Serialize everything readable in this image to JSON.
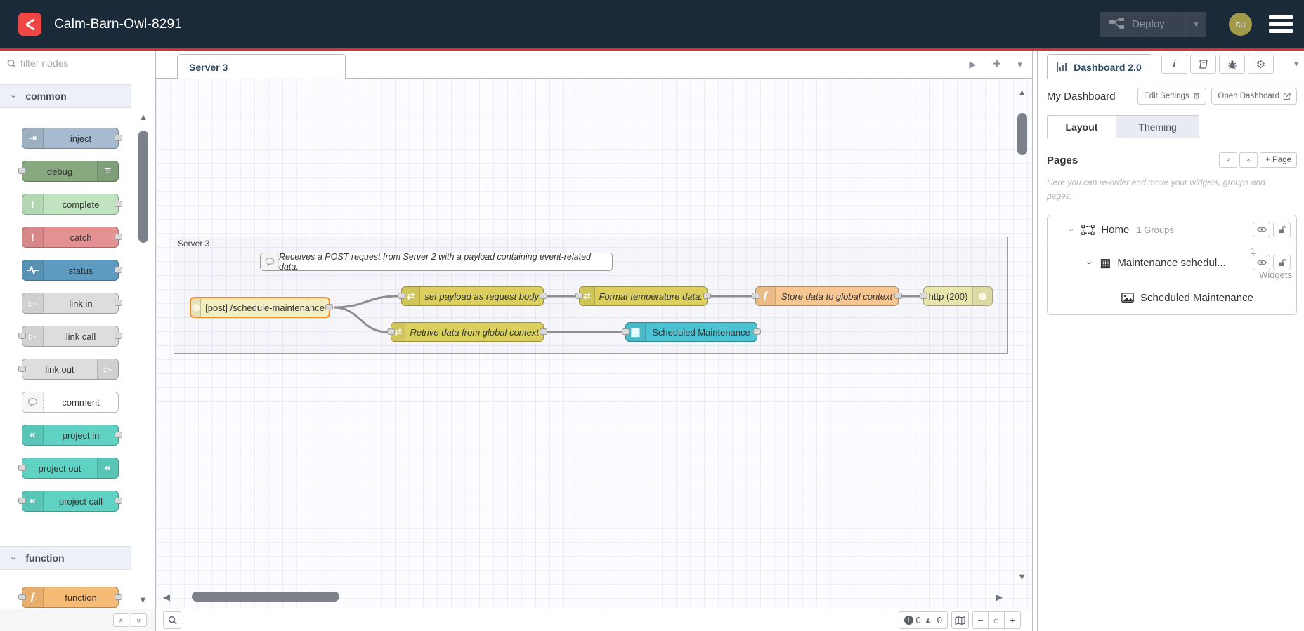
{
  "header": {
    "title": "Calm-Barn-Owl-8291",
    "deploy_label": "Deploy",
    "avatar_initials": "su"
  },
  "palette": {
    "filter_placeholder": "filter nodes",
    "categories": [
      {
        "label": "common",
        "items": [
          {
            "label": "inject",
            "color": "#a6bbcf"
          },
          {
            "label": "debug",
            "color": "#87a980"
          },
          {
            "label": "complete",
            "color": "#bfe4bf"
          },
          {
            "label": "catch",
            "color": "#e49191"
          },
          {
            "label": "status",
            "color": "#5d9cc0"
          },
          {
            "label": "link in",
            "color": "#dddddd"
          },
          {
            "label": "link call",
            "color": "#dddddd"
          },
          {
            "label": "link out",
            "color": "#dddddd"
          },
          {
            "label": "comment",
            "color": "#ffffff"
          },
          {
            "label": "project in",
            "color": "#5fd2c3"
          },
          {
            "label": "project out",
            "color": "#5fd2c3"
          },
          {
            "label": "project call",
            "color": "#5fd2c3"
          }
        ]
      },
      {
        "label": "function",
        "items": [
          {
            "label": "function",
            "color": "#f5ba75"
          }
        ]
      }
    ]
  },
  "tabs": {
    "active_flow": "Server 3"
  },
  "flow": {
    "group_label": "Server 3",
    "comment_text": "Receives a POST request from Server 2 with a payload containing event-related data.",
    "nodes": [
      {
        "label": "[post] /schedule-maintenance",
        "color": "#f3eec1",
        "selected": true
      },
      {
        "label": "set payload as request body",
        "color": "#dbd05e"
      },
      {
        "label": "Format temperature data.",
        "color": "#dbd05e"
      },
      {
        "label": "Store data to global context",
        "color": "#f8c690"
      },
      {
        "label": "http (200)",
        "color": "#e8e6ad"
      },
      {
        "label": "Retrive data from global context",
        "color": "#dbd05e"
      },
      {
        "label": "Scheduled Maintenance",
        "color": "#4cc3d3"
      }
    ]
  },
  "canvas_footer": {
    "error_count": "0",
    "warning_count": "0"
  },
  "sidebar": {
    "tab_label": "Dashboard 2.0",
    "dashboard_name": "My Dashboard",
    "edit_settings_label": "Edit Settings",
    "open_dashboard_label": "Open Dashboard",
    "tabs": {
      "layout": "Layout",
      "theming": "Theming"
    },
    "pages": {
      "heading": "Pages",
      "add_page_label": "+ Page",
      "help_text": "Here you can re-order and move your widgets, groups and pages."
    },
    "tree": {
      "page": {
        "label": "Home",
        "meta": "1 Groups"
      },
      "group": {
        "label": "Maintenance schedul...",
        "meta_count": "1",
        "meta_word": "Widgets"
      },
      "widget": {
        "label": "Scheduled Maintenance"
      }
    }
  },
  "icons": {
    "inject": "⇥",
    "debug_list": "≡",
    "exclaim": "!",
    "link_arrow": "▻",
    "project": "«",
    "function_f": "ƒ",
    "change": "⇄",
    "globe": "⊕",
    "table": "▦",
    "chevron": "›",
    "caret_down": "▾",
    "tri_up": "▲",
    "tri_down": "▼",
    "tri_left": "◀",
    "tri_right": "▶",
    "plus": "+",
    "minus": "−",
    "circle": "○",
    "dbl_chev_up": "«",
    "dbl_chev_down": "»",
    "gear": "⚙",
    "info": "i",
    "warning_tri": "▲"
  },
  "colors": {
    "header_bg": "#1b2a38",
    "accent_red": "#dd2c2c",
    "logo_red": "#ee4545",
    "avatar_bg": "#a29a4b",
    "deploy_bg": "#39434f",
    "selected_node_border": "#ff8822",
    "wire": "#8f8f8f",
    "grid_line": "#edeff6",
    "canvas_bg": "#fcfcfe",
    "category_bg": "#eef0f7",
    "inactive_tab_bg": "#e9ebf2",
    "scrollbar_thumb": "#7b808b"
  }
}
